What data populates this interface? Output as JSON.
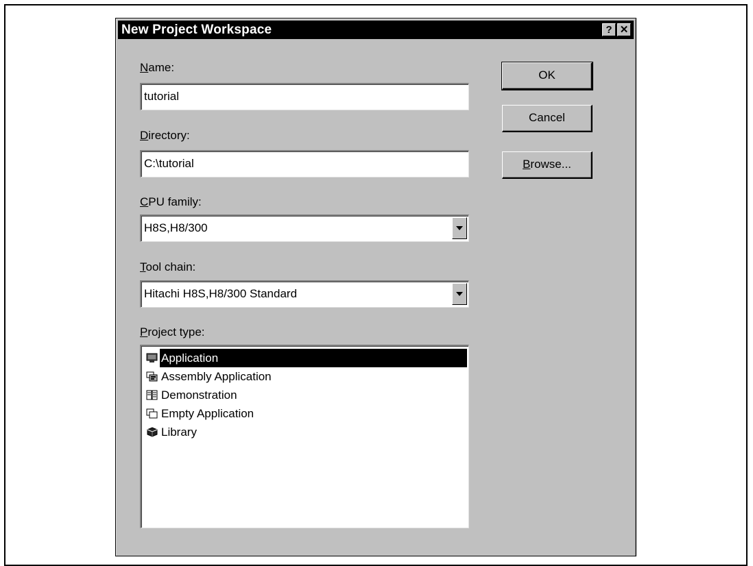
{
  "dialog": {
    "title": "New Project Workspace",
    "help_glyph": "?",
    "close_glyph": "✕"
  },
  "name": {
    "label_mnemonic": "N",
    "label_rest": "ame:",
    "value": "tutorial"
  },
  "directory": {
    "label_mnemonic": "D",
    "label_rest": "irectory:",
    "value": "C:\\tutorial"
  },
  "cpu_family": {
    "label_mnemonic": "C",
    "label_rest": "PU family:",
    "value": "H8S,H8/300"
  },
  "tool_chain": {
    "label_mnemonic": "T",
    "label_rest": "ool chain:",
    "value": "Hitachi H8S,H8/300 Standard"
  },
  "project_type": {
    "label_mnemonic": "P",
    "label_rest": "roject type:",
    "items": [
      {
        "label": "Application",
        "icon": "application-icon",
        "selected": true
      },
      {
        "label": "Assembly Application",
        "icon": "assembly-application-icon",
        "selected": false
      },
      {
        "label": "Demonstration",
        "icon": "demonstration-icon",
        "selected": false
      },
      {
        "label": "Empty Application",
        "icon": "empty-application-icon",
        "selected": false
      },
      {
        "label": "Library",
        "icon": "library-icon",
        "selected": false
      }
    ]
  },
  "buttons": {
    "ok": "OK",
    "cancel": "Cancel",
    "browse_mnemonic": "B",
    "browse_rest": "rowse..."
  }
}
